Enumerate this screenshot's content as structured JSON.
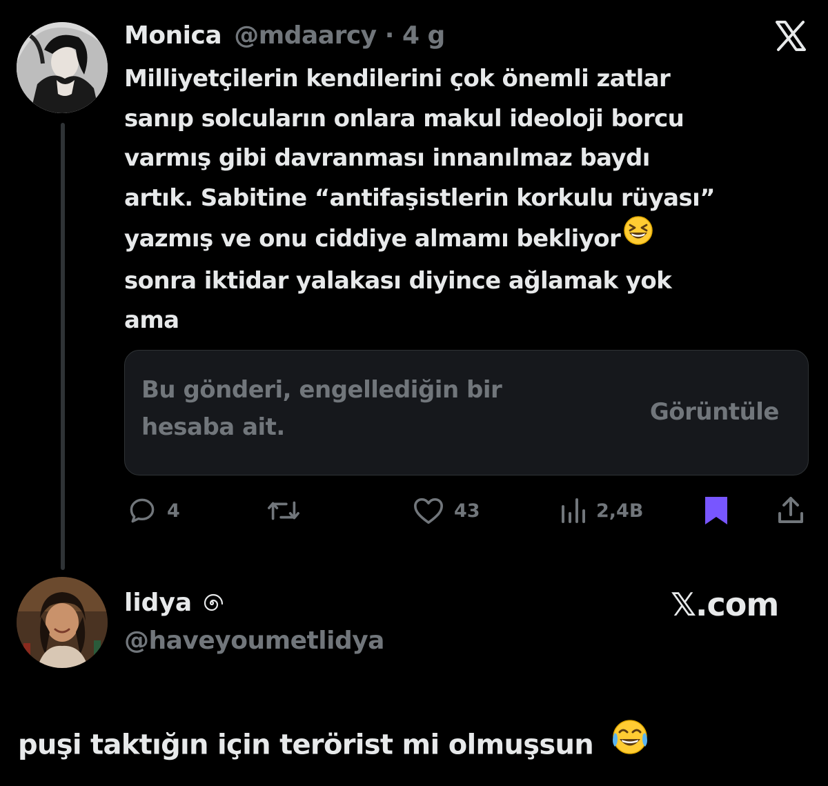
{
  "tweet": {
    "author_name": "Monica",
    "author_handle": "@mdaarcy",
    "separator": "·",
    "time": "4 g",
    "text_lines": [
      "Milliyetçilerin kendilerini çok önemli zatlar",
      "sanıp solcuların onlara makul ideoloji borcu",
      "varmış gibi davranması innanılmaz baydı",
      "artık. Sabitine “antifaşistlerin korkulu rüyası”",
      "yazmış ve onu ciddiye almamı bekliyor",
      "sonra iktidar yalakası diyince ağlamak yok",
      "ama"
    ],
    "emoji_icon": "grinning-squinting-face-icon",
    "quote": {
      "text_line1": "Bu gönderi, engellediğin bir",
      "text_line2": "hesaba ait.",
      "view_label": "Görüntüle"
    },
    "actions": {
      "replies": "4",
      "likes": "43",
      "views": "2,4B"
    },
    "accent_bookmark_color": "#7856ff"
  },
  "reply": {
    "author_name": "lidya",
    "author_handle": "@haveyoumetlidya",
    "badge_icon": "spiral-icon",
    "watermark": "𝕏.com",
    "text": "puşi taktığın için terörist mi olmuşsun",
    "emoji_icon": "face-with-tears-of-joy-icon"
  },
  "colors": {
    "background": "#000000",
    "text": "#e7e9ea",
    "muted": "#71767b",
    "quote_bg": "#16181c"
  }
}
